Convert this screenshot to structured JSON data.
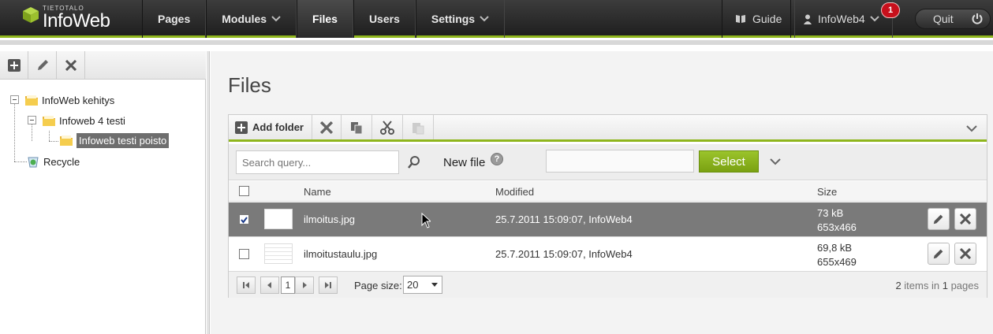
{
  "brand": {
    "small": "TIETOTALO",
    "name": "InfoWeb"
  },
  "nav": [
    {
      "label": "Pages",
      "dropdown": false
    },
    {
      "label": "Modules",
      "dropdown": true
    },
    {
      "label": "Files",
      "dropdown": false,
      "active": true
    },
    {
      "label": "Users",
      "dropdown": false
    },
    {
      "label": "Settings",
      "dropdown": true
    }
  ],
  "right_nav": {
    "guide": "Guide",
    "user": "InfoWeb4",
    "notifications": "1",
    "quit": "Quit"
  },
  "tree": {
    "root": "InfoWeb kehitys",
    "child": "Infoweb 4 testi",
    "grandchild": "Infoweb testi poisto",
    "recycle": "Recycle"
  },
  "main": {
    "title": "Files",
    "toolbar": {
      "add_folder": "Add folder"
    },
    "search": {
      "placeholder": "Search query..."
    },
    "new_file": "New file",
    "help": "?",
    "select_button": "Select",
    "columns": {
      "name": "Name",
      "modified": "Modified",
      "size": "Size"
    },
    "rows": [
      {
        "name": "ilmoitus.jpg",
        "modified": "25.7.2011 15:09:07, InfoWeb4",
        "size": "73 kB",
        "dims": "653x466",
        "checked": true
      },
      {
        "name": "ilmoitustaulu.jpg",
        "modified": "25.7.2011 15:09:07, InfoWeb4",
        "size": "69,8 kB",
        "dims": "655x469",
        "checked": false
      }
    ],
    "pager": {
      "page": "1",
      "page_size_label": "Page size:",
      "page_size": "20",
      "total_items": "2",
      "items_in": "items in",
      "total_pages": "1",
      "pages": "pages"
    }
  },
  "colors": {
    "accent": "#8fb61d",
    "topbar": "#2a2a2a",
    "badge": "#c8101c",
    "selected_row": "#7a7a7a"
  }
}
